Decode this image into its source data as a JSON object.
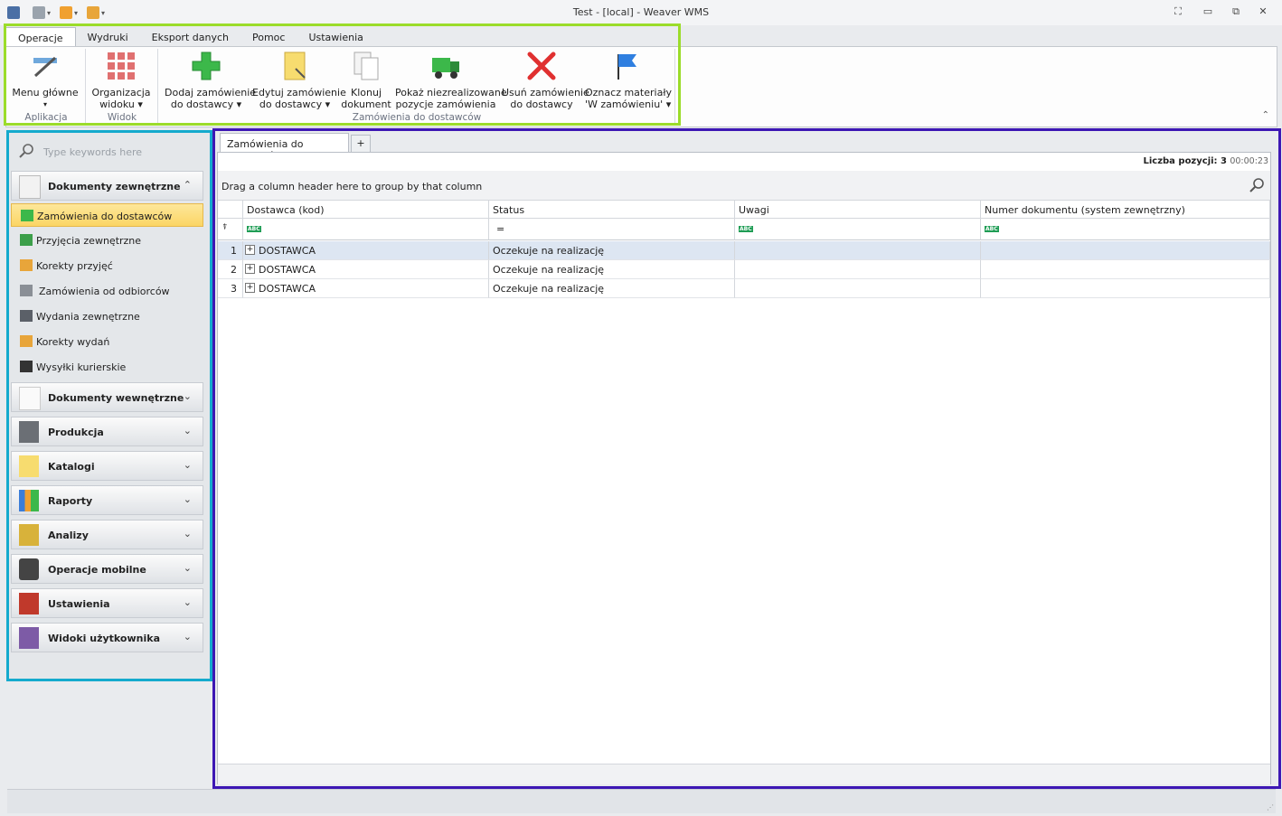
{
  "window": {
    "title": "Test - [local] - Weaver WMS"
  },
  "ribbon": {
    "tabs": [
      "Operacje",
      "Wydruki",
      "Eksport danych",
      "Pomoc",
      "Ustawienia"
    ],
    "buttons": {
      "menu_glowne": "Menu główne",
      "organizacja": "Organizacja",
      "organizacja2": "widoku",
      "dodaj": "Dodaj zamówienie",
      "dodaj2": "do dostawcy",
      "edytuj": "Edytuj zamówienie",
      "edytuj2": "do dostawcy",
      "klonuj": "Klonuj",
      "klonuj2": "dokument",
      "pokaz": "Pokaż niezrealizowane",
      "pokaz2": "pozycje zamówienia",
      "usun": "Usuń zamówienie",
      "usun2": "do dostawcy",
      "oznacz": "Oznacz materiały",
      "oznacz2": "'W zamówieniu'"
    },
    "groups": {
      "aplikacja": "Aplikacja",
      "widok": "Widok",
      "zamowienia": "Zamówienia do dostawców"
    }
  },
  "sidebar": {
    "search_placeholder": "Type keywords here",
    "groups": [
      "Dokumenty zewnętrzne",
      "Dokumenty wewnętrzne",
      "Produkcja",
      "Katalogi",
      "Raporty",
      "Analizy",
      "Operacje mobilne",
      "Ustawienia",
      "Widoki użytkownika"
    ],
    "items": [
      "Zamówienia do dostawców",
      "Przyjęcia zewnętrzne",
      "Korekty przyjęć",
      "Zamówienia od odbiorców",
      "Wydania zewnętrzne",
      "Korekty wydań",
      "Wysyłki kurierskie"
    ]
  },
  "main": {
    "tab": "Zamówienia do dostawców",
    "add_tab": "+",
    "count_label": "Liczba pozycji: 3",
    "time": "00:00:23",
    "group_hint": "Drag a column header here to group by that column",
    "columns": [
      "Dostawca (kod)",
      "Status",
      "Uwagi",
      "Numer dokumentu (system zewnętrzny)"
    ],
    "filter_abc": "ABC",
    "filter_eq": "=",
    "rows": [
      {
        "n": "1",
        "dostawca": "DOSTAWCA",
        "status": "Oczekuje na realizację",
        "uwagi": "",
        "numer": ""
      },
      {
        "n": "2",
        "dostawca": "DOSTAWCA",
        "status": "Oczekuje na realizację",
        "uwagi": "",
        "numer": ""
      },
      {
        "n": "3",
        "dostawca": "DOSTAWCA",
        "status": "Oczekuje na realizację",
        "uwagi": "",
        "numer": ""
      }
    ]
  },
  "colors": {
    "highlight_green": "#9bdc2a",
    "highlight_cyan": "#14aacd",
    "highlight_purple": "#3d17b4",
    "selected_item": "#fbd565"
  }
}
